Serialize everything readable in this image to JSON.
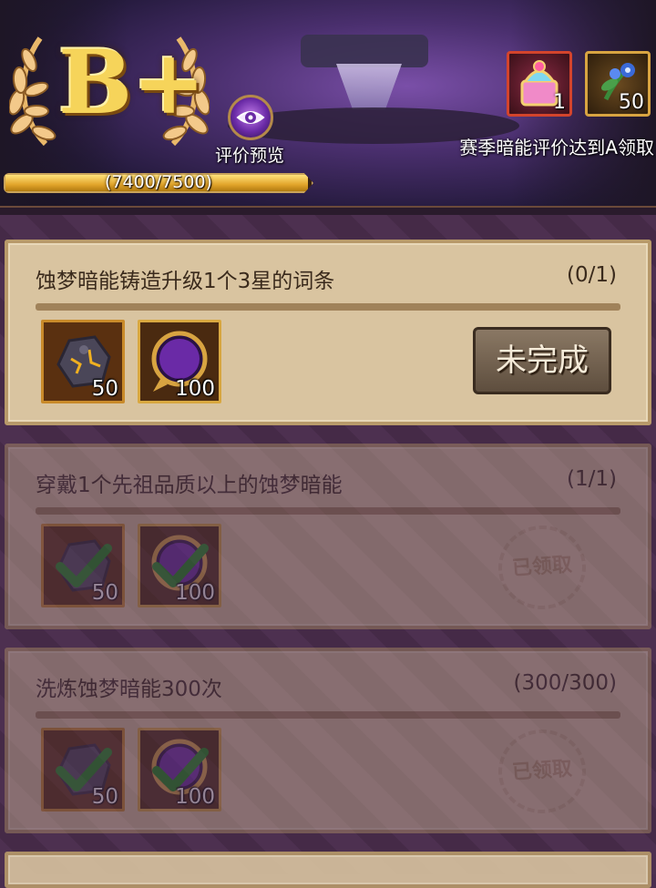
{
  "header": {
    "grade": "B+",
    "preview_label": "评价预览",
    "progress_text": "(7400/7500)",
    "progress_fraction": 0.987,
    "season_reward_text": "赛季暗能评价达到A领取",
    "rewards": [
      {
        "icon": "potion-chest-icon",
        "qty": "1"
      },
      {
        "icon": "blue-flower-icon",
        "qty": "50"
      }
    ]
  },
  "tasks": [
    {
      "title": "蚀梦暗能铸造升级1个3星的词条",
      "progress": "(0/1)",
      "items": [
        {
          "icon": "dark-ore-icon",
          "qty": "50"
        },
        {
          "icon": "moon-orb-icon",
          "qty": "100"
        }
      ],
      "status": "未完成"
    },
    {
      "title": "穿戴1个先祖品质以上的蚀梦暗能",
      "progress": "(1/1)",
      "items": [
        {
          "icon": "dark-ore-icon",
          "qty": "50"
        },
        {
          "icon": "moon-orb-icon",
          "qty": "100"
        }
      ],
      "status": "已领取"
    },
    {
      "title": "洗炼蚀梦暗能300次",
      "progress": "(300/300)",
      "items": [
        {
          "icon": "dark-ore-icon",
          "qty": "50"
        },
        {
          "icon": "moon-orb-icon",
          "qty": "100"
        }
      ],
      "status": "已领取"
    }
  ],
  "colors": {
    "gold": "#f6d45a",
    "panel": "#d9c4a0",
    "background": "#4a2d4f",
    "button": "#6e5c48"
  }
}
